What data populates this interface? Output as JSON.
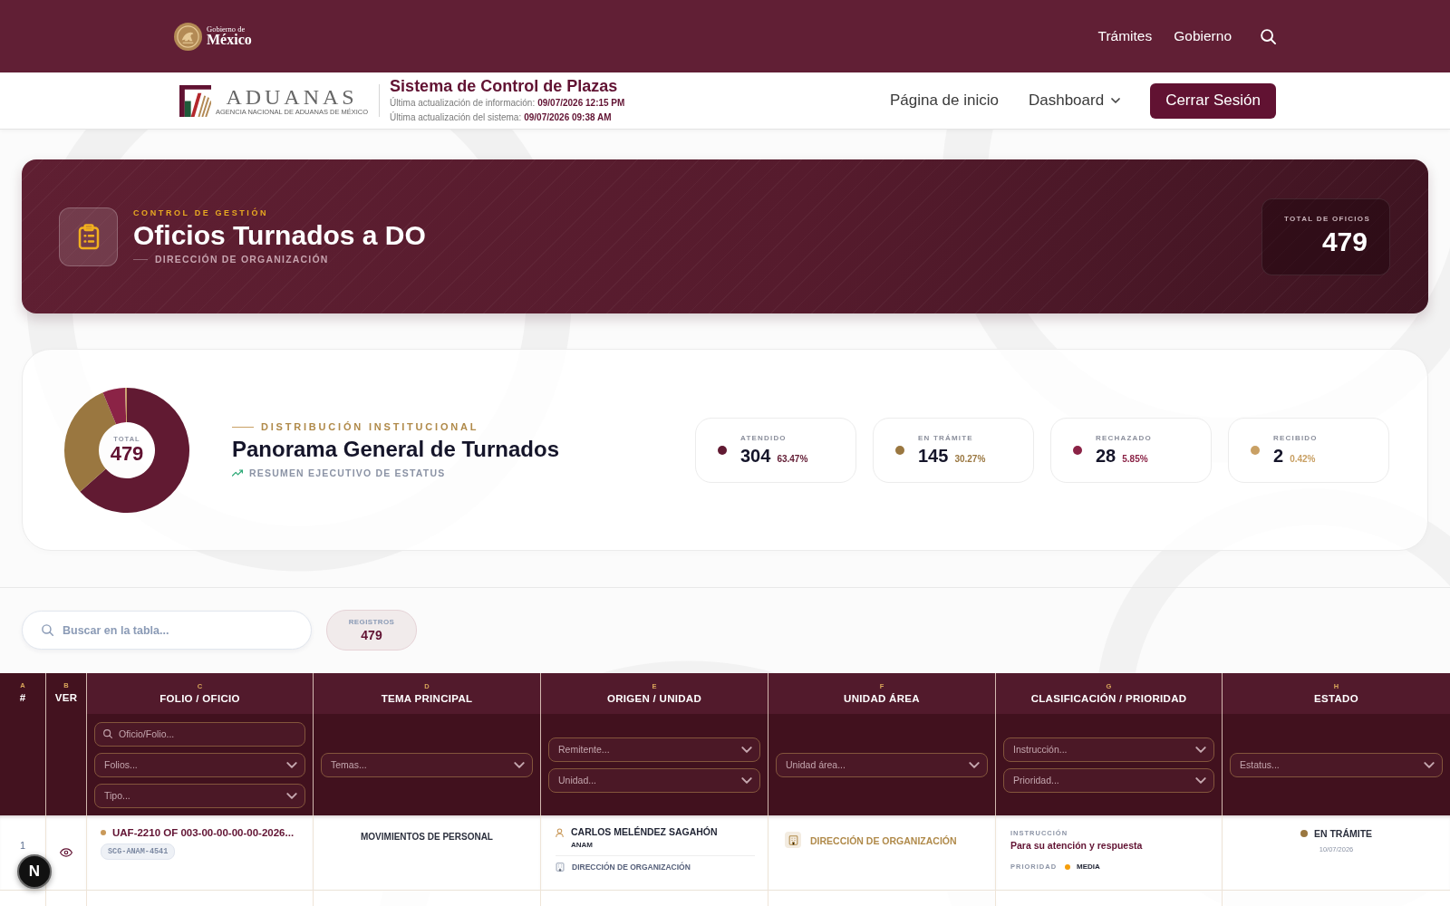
{
  "top_bar": {
    "brand": {
      "line_1": "Gobierno de",
      "line_2": "México"
    },
    "links": [
      "Trámites",
      "Gobierno"
    ]
  },
  "header": {
    "logo": {
      "wordmark": "ADUANAS",
      "tagline": "AGENCIA NACIONAL DE ADUANAS DE MÉXICO"
    },
    "title": "Sistema de Control de Plazas",
    "updates": [
      {
        "label": "Última actualización de información:",
        "value": "09/07/2026 12:15 PM"
      },
      {
        "label": "Última actualización del sistema:",
        "value": "09/07/2026 09:38 AM"
      }
    ],
    "nav": [
      {
        "label": "Página de inicio",
        "kind": "link"
      },
      {
        "label": "Dashboard",
        "kind": "dropdown"
      }
    ],
    "logout": "Cerrar Sesión"
  },
  "banner": {
    "eyebrow": "CONTROL DE GESTIÓN",
    "title": "Oficios Turnados a DO",
    "subtitle": "DIRECCIÓN DE ORGANIZACIÓN",
    "total_label": "TOTAL DE OFICIOS",
    "total": "479"
  },
  "overview": {
    "chart_data": {
      "type": "donut",
      "values": [
        63.47,
        30.27,
        5.85,
        0.42
      ]
    },
    "center_label": "TOTAL",
    "center_value": "479",
    "eyebrow": "DISTRIBUCIÓN INSTITUCIONAL",
    "title": "Panorama General de Turnados",
    "subtitle": "RESUMEN EJECUTIVO DE ESTATUS",
    "stats": [
      {
        "label": "ATENDIDO",
        "count": "304",
        "percent": "63.47%",
        "color": "#611a32"
      },
      {
        "label": "EN TRÁMITE",
        "count": "145",
        "percent": "30.27%",
        "color": "#9a7740"
      },
      {
        "label": "RECHAZADO",
        "count": "28",
        "percent": "5.85%",
        "color": "#8b2346"
      },
      {
        "label": "RECIBIDO",
        "count": "2",
        "percent": "0.42%",
        "color": "#c9a064"
      }
    ]
  },
  "toolbar": {
    "search": {
      "placeholder": "Buscar en la tabla..."
    },
    "count_label": "REGISTROS",
    "count": "479"
  },
  "table": {
    "columns": [
      {
        "letter": "A",
        "title": "#"
      },
      {
        "letter": "B",
        "title": "VER"
      },
      {
        "letter": "C",
        "title": "FOLIO / OFICIO",
        "filters": [
          {
            "kind": "search",
            "placeholder": "Oficio/Folio..."
          },
          {
            "kind": "select",
            "placeholder": "Folios..."
          },
          {
            "kind": "select",
            "placeholder": "Tipo..."
          }
        ]
      },
      {
        "letter": "D",
        "title": "TEMA PRINCIPAL",
        "filters": [
          {
            "kind": "select",
            "placeholder": "Temas..."
          }
        ]
      },
      {
        "letter": "E",
        "title": "ORIGEN / UNIDAD",
        "filters": [
          {
            "kind": "select",
            "placeholder": "Remitente..."
          },
          {
            "kind": "select",
            "placeholder": "Unidad..."
          }
        ]
      },
      {
        "letter": "F",
        "title": "UNIDAD ÁREA",
        "filters": [
          {
            "kind": "select",
            "placeholder": "Unidad área..."
          }
        ]
      },
      {
        "letter": "G",
        "title": "CLASIFICACIÓN / PRIORIDAD",
        "filters": [
          {
            "kind": "select",
            "placeholder": "Instrucción..."
          },
          {
            "kind": "select",
            "placeholder": "Prioridad..."
          }
        ]
      },
      {
        "letter": "H",
        "title": "ESTADO",
        "filters": [
          {
            "kind": "select",
            "placeholder": "Estatus..."
          }
        ]
      }
    ],
    "rows": [
      {
        "number": "1",
        "folio": {
          "text": "UAF-2210 OF 003-00-00-00-00-2026...",
          "color": "#c9995a"
        },
        "reference": "SCG-ANAM-4541",
        "topic": "MOVIMIENTOS DE PERSONAL",
        "sender": "CARLOS MELÉNDEZ SAGAHÓN",
        "sender_org": "ANAM",
        "origin_unit": "DIRECCIÓN DE ORGANIZACIÓN",
        "area_unit": "DIRECCIÓN DE ORGANIZACIÓN",
        "instruction_label": "INSTRUCCIÓN",
        "instruction": "Para su atención y respuesta",
        "priority_label": "PRIORIDAD",
        "priority": {
          "label": "MEDIA",
          "color": "#f59e0b"
        },
        "status": {
          "label": "EN TRÁMITE",
          "color": "#9a7740",
          "date": "10/07/2026"
        }
      }
    ]
  },
  "dev_badge": "N"
}
